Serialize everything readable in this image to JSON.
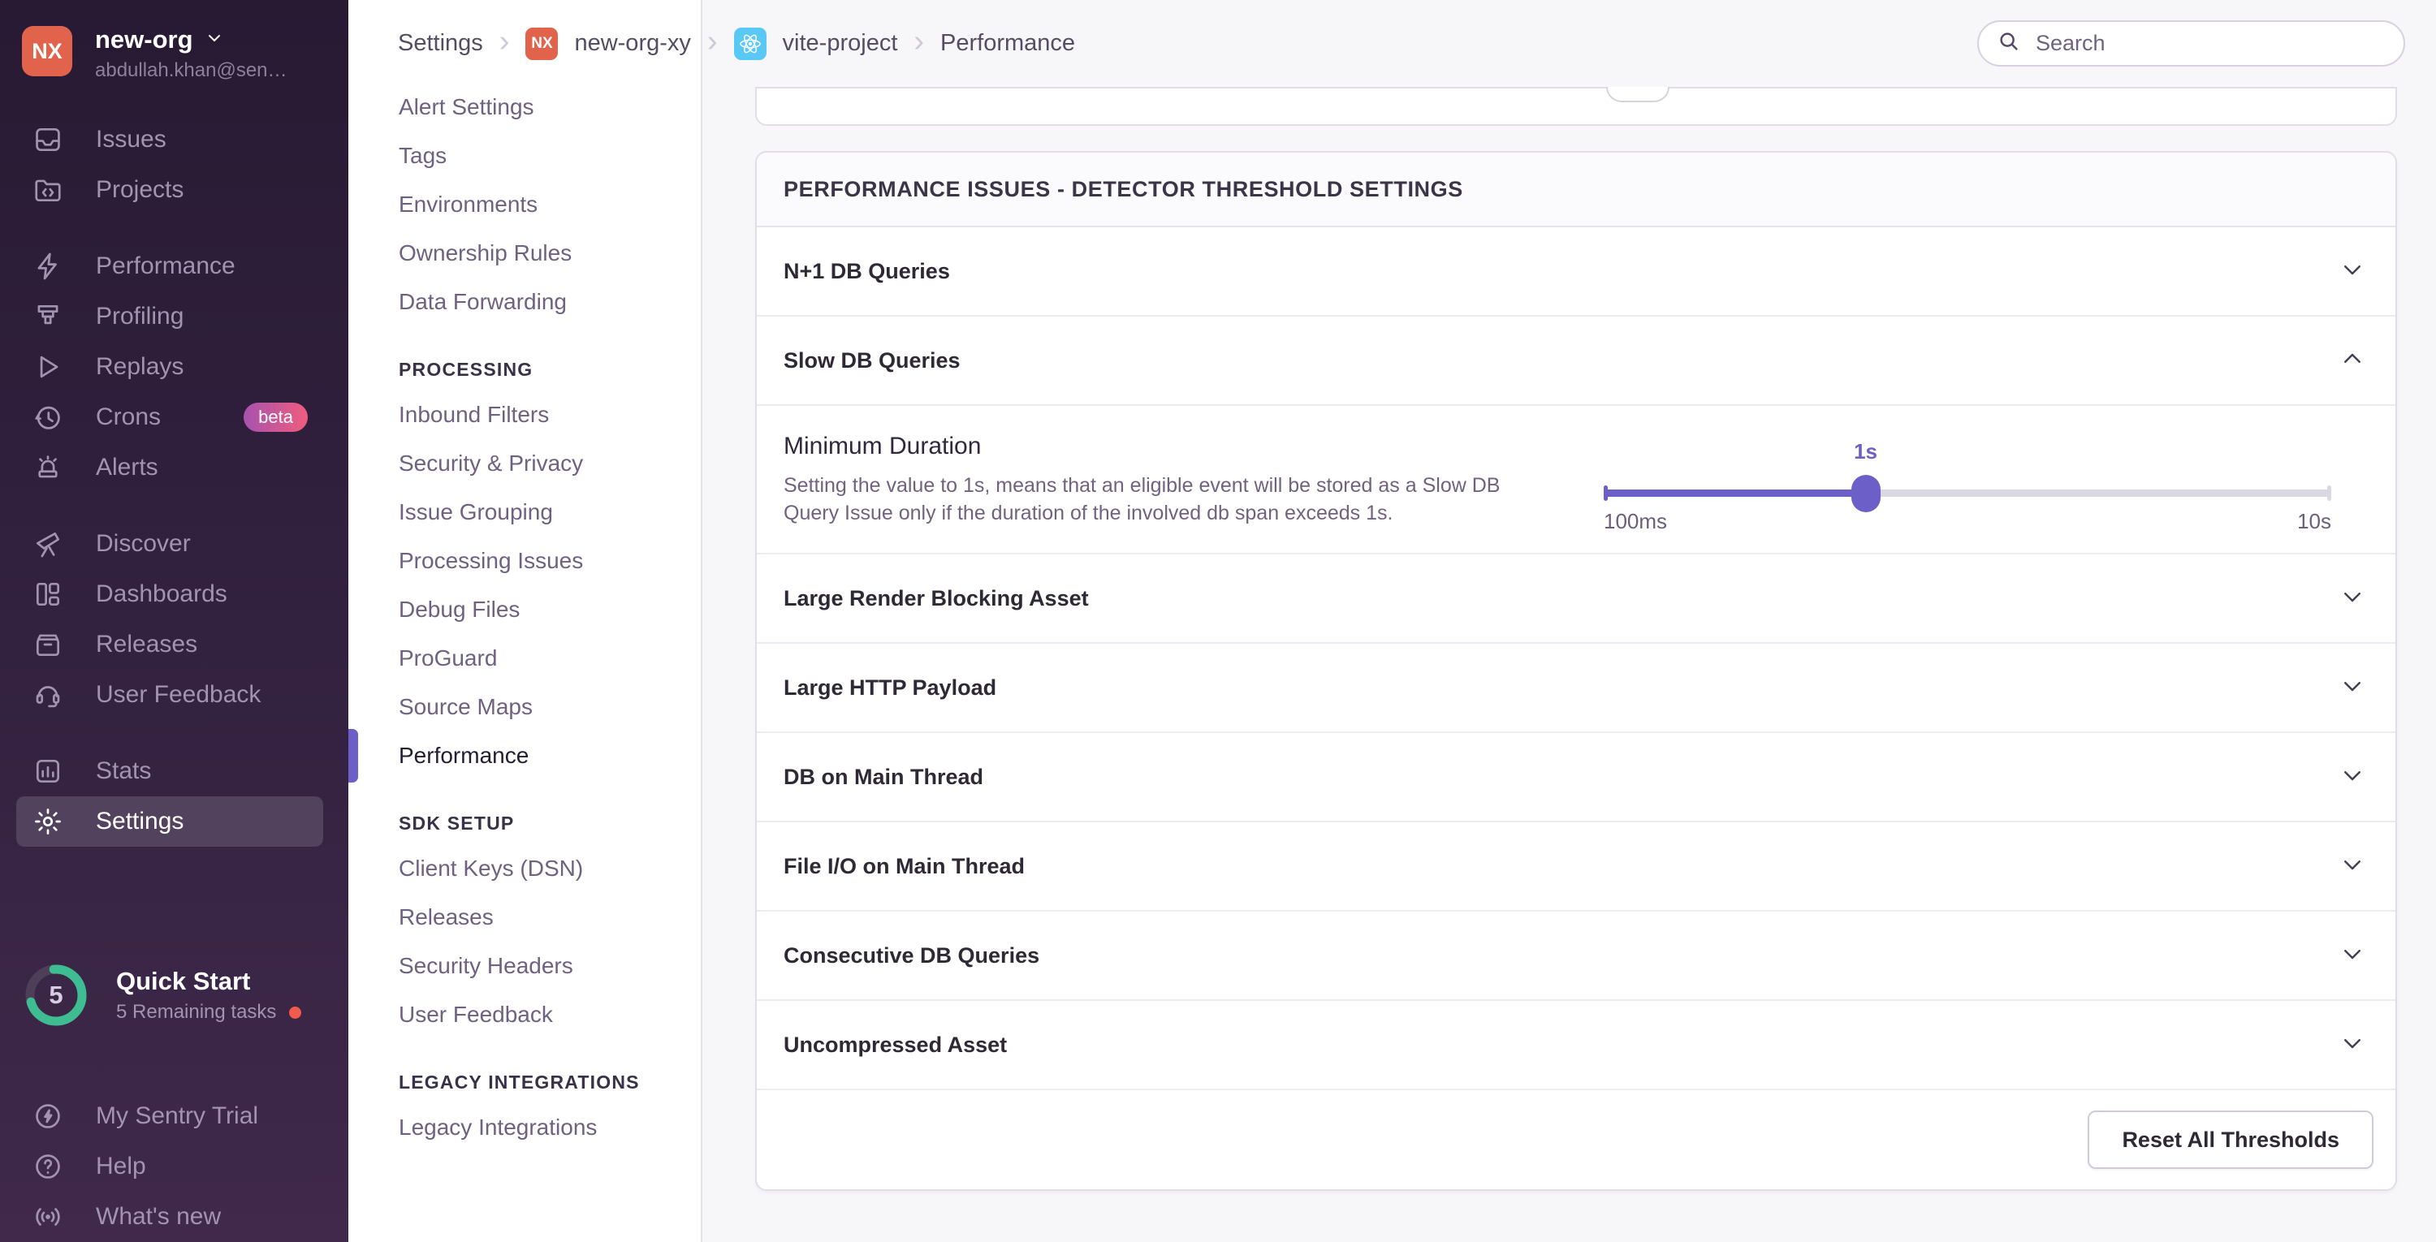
{
  "sidebar": {
    "org": {
      "initials": "NX",
      "name": "new-org",
      "email": "abdullah.khan@sen…"
    },
    "items": [
      {
        "label": "Issues"
      },
      {
        "label": "Projects"
      },
      {
        "label": "Performance"
      },
      {
        "label": "Profiling"
      },
      {
        "label": "Replays"
      },
      {
        "label": "Crons",
        "badge": "beta"
      },
      {
        "label": "Alerts"
      },
      {
        "label": "Discover"
      },
      {
        "label": "Dashboards"
      },
      {
        "label": "Releases"
      },
      {
        "label": "User Feedback"
      },
      {
        "label": "Stats"
      },
      {
        "label": "Settings"
      }
    ],
    "quick_start": {
      "title": "Quick Start",
      "subtitle": "5 Remaining tasks",
      "count": "5"
    },
    "footer_items": [
      {
        "label": "My Sentry Trial"
      },
      {
        "label": "Help"
      },
      {
        "label": "What's new"
      }
    ]
  },
  "settings_nav": {
    "items": [
      {
        "label": "Alert Settings"
      },
      {
        "label": "Tags"
      },
      {
        "label": "Environments"
      },
      {
        "label": "Ownership Rules"
      },
      {
        "label": "Data Forwarding"
      },
      {
        "label": "PROCESSING",
        "type": "header"
      },
      {
        "label": "Inbound Filters"
      },
      {
        "label": "Security & Privacy"
      },
      {
        "label": "Issue Grouping"
      },
      {
        "label": "Processing Issues"
      },
      {
        "label": "Debug Files"
      },
      {
        "label": "ProGuard"
      },
      {
        "label": "Source Maps"
      },
      {
        "label": "Performance",
        "active": true
      },
      {
        "label": "SDK SETUP",
        "type": "header"
      },
      {
        "label": "Client Keys (DSN)"
      },
      {
        "label": "Releases"
      },
      {
        "label": "Security Headers"
      },
      {
        "label": "User Feedback"
      },
      {
        "label": "LEGACY INTEGRATIONS",
        "type": "header"
      },
      {
        "label": "Legacy Integrations"
      }
    ]
  },
  "breadcrumb": {
    "items": [
      "Settings",
      "new-org-xy",
      "vite-project",
      "Performance"
    ],
    "org_badge": "NX"
  },
  "search": {
    "placeholder": "Search"
  },
  "panel": {
    "title": "PERFORMANCE ISSUES - DETECTOR THRESHOLD SETTINGS",
    "rows": [
      {
        "label": "N+1 DB Queries",
        "state": "collapsed"
      },
      {
        "label": "Slow DB Queries",
        "state": "expanded"
      },
      {
        "label": "Large Render Blocking Asset",
        "state": "collapsed"
      },
      {
        "label": "Large HTTP Payload",
        "state": "collapsed"
      },
      {
        "label": "DB on Main Thread",
        "state": "collapsed"
      },
      {
        "label": "File I/O on Main Thread",
        "state": "collapsed"
      },
      {
        "label": "Consecutive DB Queries",
        "state": "collapsed"
      },
      {
        "label": "Uncompressed Asset",
        "state": "collapsed"
      }
    ],
    "expanded": {
      "setting_label": "Minimum Duration",
      "description": "Setting the value to 1s, means that an eligible event will be stored as a Slow DB Query Issue only if the duration of the involved db span exceeds 1s.",
      "slider": {
        "value_label": "1s",
        "min_label": "100ms",
        "max_label": "10s",
        "percent": 36
      }
    },
    "reset_button": "Reset All Thresholds"
  },
  "colors": {
    "accent": "#6c5fc7",
    "org_avatar": "#e2634c",
    "react_badge": "#5ac8f5",
    "beta_from": "#a653ae",
    "beta_to": "#f05c7e",
    "progress_green": "#3dbd91",
    "alert_dot": "#f25a4e"
  }
}
